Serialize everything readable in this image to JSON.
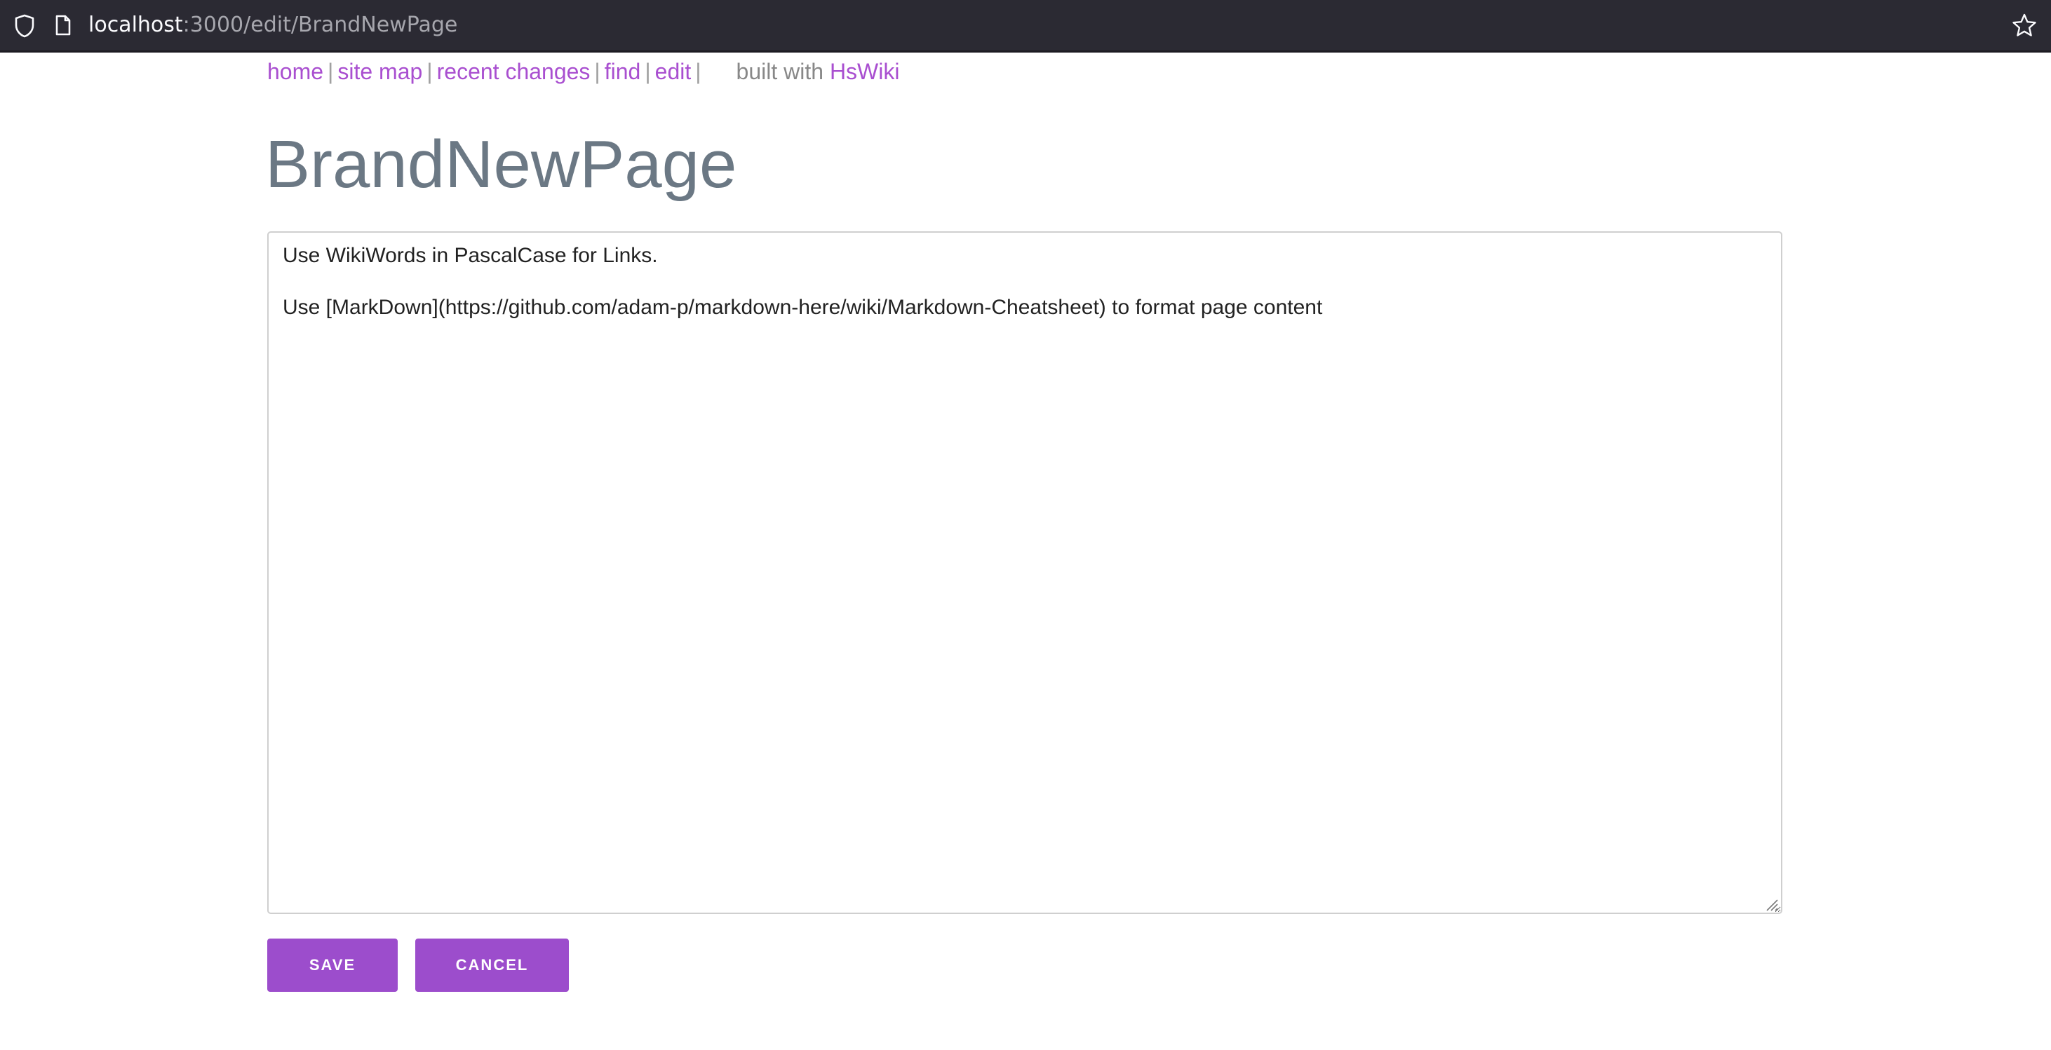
{
  "browser": {
    "url_host": "localhost",
    "url_rest": ":3000/edit/BrandNewPage"
  },
  "nav": {
    "links": [
      "home",
      "site map",
      "recent changes",
      "find",
      "edit"
    ],
    "separator": "|",
    "built_with_label": "built with",
    "built_with_link": "HsWiki"
  },
  "page": {
    "title": "BrandNewPage"
  },
  "editor": {
    "content": "Use WikiWords in PascalCase for Links.\n\nUse [MarkDown](https://github.com/adam-p/markdown-here/wiki/Markdown-Cheatsheet) to format page content"
  },
  "actions": {
    "save_label": "SAVE",
    "cancel_label": "CANCEL"
  },
  "colors": {
    "link": "#a94fd0",
    "button": "#9c4dcc",
    "title": "#6b7884",
    "browser_bar": "#2b2a33"
  },
  "icons": [
    "shield-icon",
    "page-icon",
    "bookmark-star-icon",
    "resize-grip-icon"
  ]
}
